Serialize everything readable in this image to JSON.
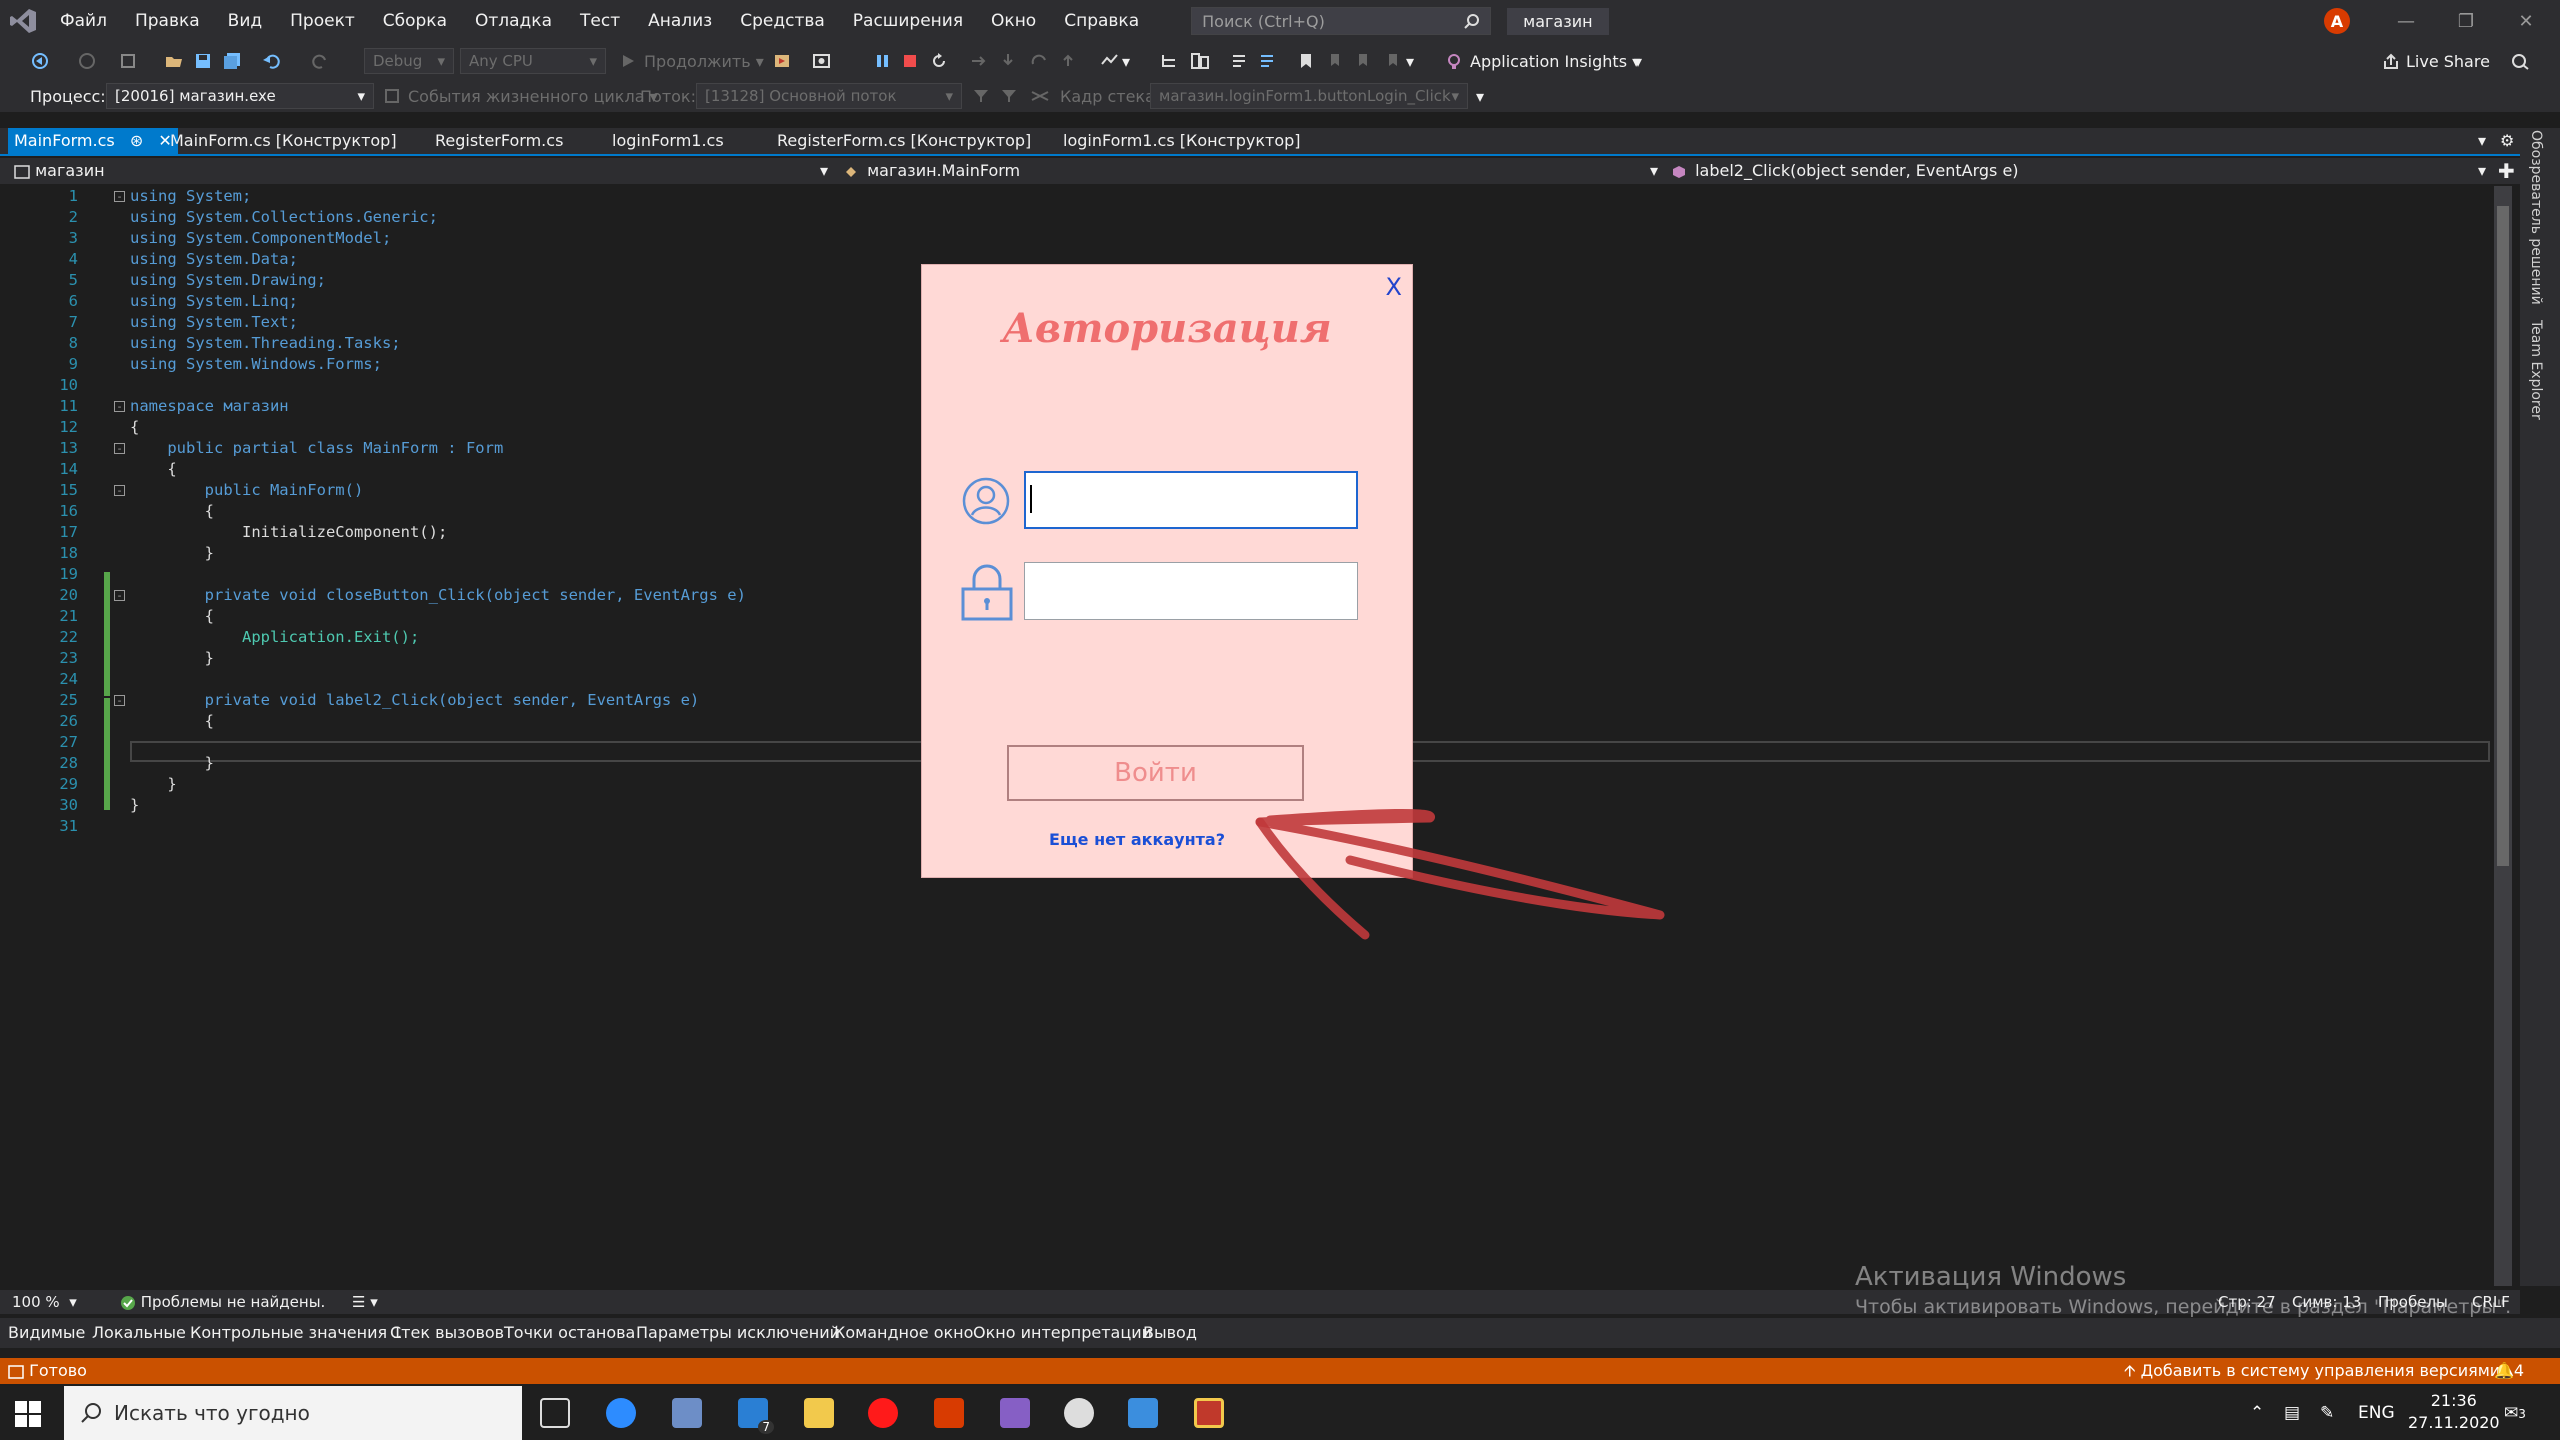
{
  "menu": {
    "items": [
      "Файл",
      "Правка",
      "Вид",
      "Проект",
      "Сборка",
      "Отладка",
      "Тест",
      "Анализ",
      "Средства",
      "Расширения",
      "Окно",
      "Справка"
    ],
    "search_placeholder": "Поиск (Ctrl+Q)",
    "solution_name": "магазин",
    "avatar_letter": "A"
  },
  "toolbar": {
    "config": "Debug",
    "platform": "Any CPU",
    "continue_label": "Продолжить",
    "app_insights": "Application Insights",
    "live_share": "Live Share"
  },
  "debug_toolbar": {
    "process_label": "Процесс:",
    "process_value": "[20016] магазин.exe",
    "lifecycle_label": "События жизненного цикла",
    "thread_label": "Поток:",
    "thread_value": "[13128] Основной поток",
    "stack_label": "Кадр стека:",
    "stack_value": "магазин.loginForm1.buttonLogin_Click"
  },
  "tabs": [
    {
      "label": "MainForm.cs",
      "active": true
    },
    {
      "label": "MainForm.cs [Конструктор]",
      "active": false
    },
    {
      "label": "RegisterForm.cs",
      "active": false
    },
    {
      "label": "loginForm1.cs",
      "active": false
    },
    {
      "label": "RegisterForm.cs [Конструктор]",
      "active": false
    },
    {
      "label": "loginForm1.cs [Конструктор]",
      "active": false
    }
  ],
  "navbar": {
    "project": "магазин",
    "class": "магазин.MainForm",
    "member": "label2_Click(object sender, EventArgs e)"
  },
  "code": {
    "line_numbers": [
      "1",
      "2",
      "3",
      "4",
      "5",
      "6",
      "7",
      "8",
      "9",
      "10",
      "11",
      "12",
      "13",
      "14",
      "15",
      "16",
      "17",
      "18",
      "19",
      "20",
      "21",
      "22",
      "23",
      "24",
      "25",
      "26",
      "27",
      "28",
      "29",
      "30",
      "31"
    ],
    "lines": [
      "using System;",
      "using System.Collections.Generic;",
      "using System.ComponentModel;",
      "using System.Data;",
      "using System.Drawing;",
      "using System.Linq;",
      "using System.Text;",
      "using System.Threading.Tasks;",
      "using System.Windows.Forms;",
      "",
      "namespace магазин",
      "{",
      "    public partial class MainForm : Form",
      "    {",
      "        public MainForm()",
      "        {",
      "            InitializeComponent();",
      "        }",
      "",
      "        private void closeButton_Click(object sender, EventArgs e)",
      "        {",
      "            Application.Exit();",
      "        }",
      "",
      "        private void label2_Click(object sender, EventArgs e)",
      "        {",
      "",
      "        }",
      "    }",
      "}",
      ""
    ]
  },
  "side_panels": [
    "Обозреватель решений",
    "Team Explorer"
  ],
  "editor_status": {
    "zoom": "100 %",
    "issues": "Проблемы не найдены.",
    "line": "Стр: 27",
    "col": "Симв: 13",
    "spaces": "Пробелы",
    "eol": "CRLF"
  },
  "bottom_tabs": [
    "Видимые",
    "Локальные",
    "Контрольные значения 1",
    "Стек вызовов",
    "Точки останова",
    "Параметры исключений",
    "Командное окно",
    "Окно интерпретации",
    "Вывод"
  ],
  "statusbar": {
    "ready": "Готово",
    "source_control": "Добавить в систему управления версиями",
    "notifications": "4"
  },
  "activation": {
    "title": "Активация Windows",
    "subtitle": "Чтобы активировать Windows, перейдите в раздел \"Параметры\"."
  },
  "login": {
    "title": "Авторизация",
    "close": "X",
    "username_value": "",
    "password_value": "",
    "button": "Войти",
    "register_link": "Еще нет аккаунта?"
  },
  "taskbar": {
    "search_placeholder": "Искать что угодно",
    "mail_badge": "7",
    "language": "ENG",
    "time": "21:36",
    "date": "27.11.2020",
    "notif_count": "3"
  },
  "colors": {
    "accent": "#007acc",
    "statusbar": "#ca5100",
    "dialog_bg": "#ffd9d6",
    "title_color": "#ef6f6f",
    "link_color": "#1a4fd6",
    "arrow_color": "#c0393b"
  }
}
